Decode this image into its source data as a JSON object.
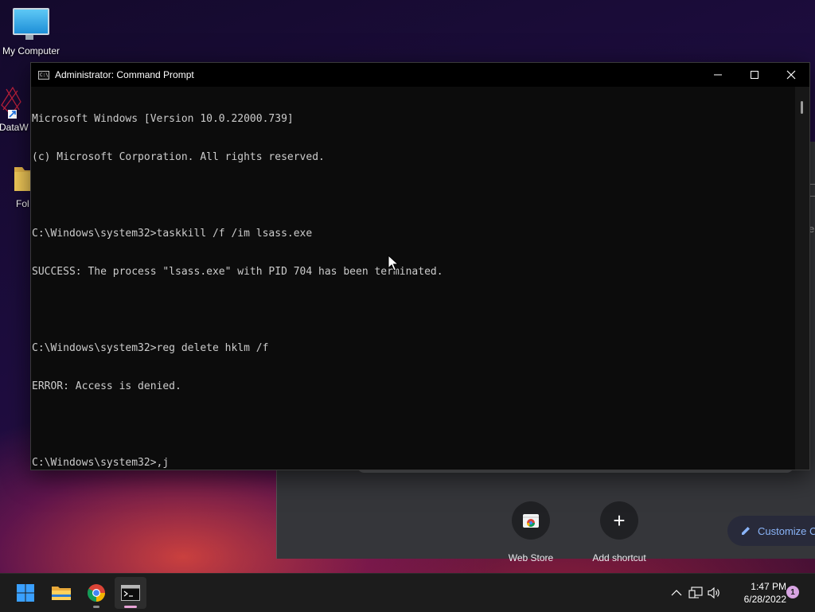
{
  "desktop": {
    "icons": [
      {
        "label": "My Computer",
        "icon": "monitor-icon"
      },
      {
        "label": "DataW",
        "icon": "shortcut-icon"
      },
      {
        "label": "Fol",
        "icon": "folder-icon"
      }
    ]
  },
  "chrome_background": {
    "shortcuts": [
      {
        "label": "Web Store",
        "icon": "web-store-icon"
      },
      {
        "label": "Add shortcut",
        "icon": "plus-icon"
      }
    ],
    "customize_label": "Customize C",
    "edge_text": "e"
  },
  "cmd": {
    "title": "Administrator: Command Prompt",
    "lines": [
      "Microsoft Windows [Version 10.0.22000.739]",
      "(c) Microsoft Corporation. All rights reserved.",
      "",
      "C:\\Windows\\system32>taskkill /f /im lsass.exe",
      "SUCCESS: The process \"lsass.exe\" with PID 704 has been terminated.",
      "",
      "C:\\Windows\\system32>reg delete hklm /f",
      "ERROR: Access is denied.",
      "",
      "C:\\Windows\\system32>,j"
    ]
  },
  "taskbar": {
    "apps": [
      {
        "name": "Start",
        "icon": "windows-start-icon"
      },
      {
        "name": "File Explorer",
        "icon": "folder-icon"
      },
      {
        "name": "Google Chrome",
        "icon": "chrome-icon"
      },
      {
        "name": "Command Prompt",
        "icon": "terminal-icon"
      }
    ],
    "tray_icons": [
      "chevron-up-icon",
      "network-icon",
      "volume-icon"
    ],
    "time": "1:47 PM",
    "date": "6/28/2022",
    "notification_count": "1"
  },
  "colors": {
    "console_bg": "#0c0c0c",
    "console_text": "#cccccc",
    "taskbar_bg": "#1c1c1c",
    "chrome_bg": "#35363a",
    "chrome_link": "#8ab4f8"
  }
}
